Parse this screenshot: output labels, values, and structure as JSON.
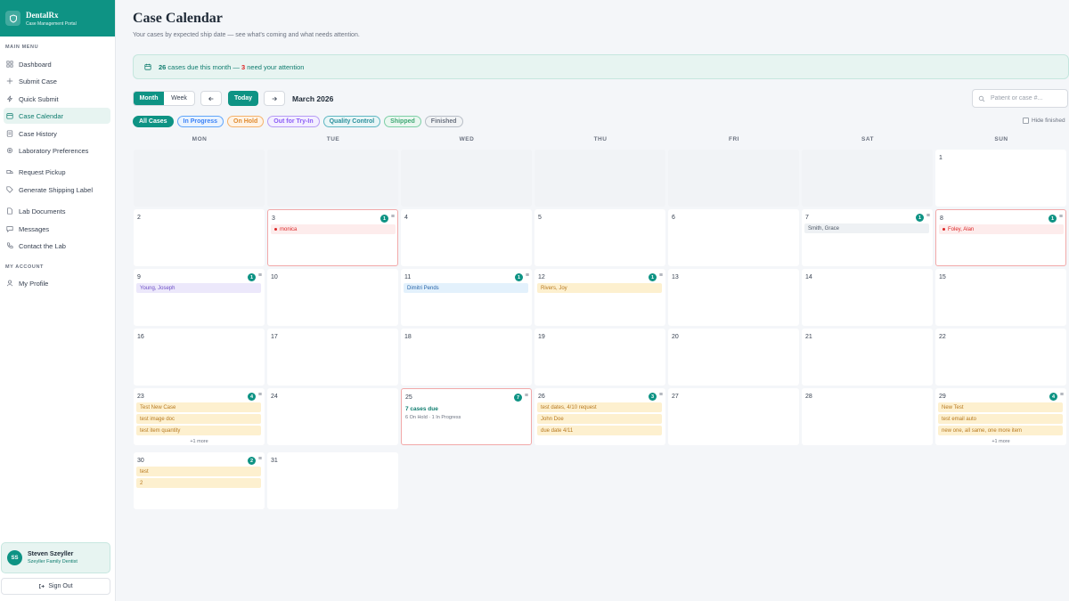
{
  "brand": {
    "name": "DentalRx",
    "sub": "Case Management Portal"
  },
  "sidebar": {
    "main_label": "MAIN MENU",
    "account_label": "MY ACCOUNT",
    "items": [
      {
        "label": "Dashboard",
        "icon": "grid-icon"
      },
      {
        "label": "Submit Case",
        "icon": "plus-icon"
      },
      {
        "label": "Quick Submit",
        "icon": "bolt-icon"
      },
      {
        "label": "Case Calendar",
        "icon": "calendar-icon"
      },
      {
        "label": "Case History",
        "icon": "history-icon"
      },
      {
        "label": "Laboratory Preferences",
        "icon": "gear-icon"
      },
      {
        "label": "Request Pickup",
        "icon": "truck-icon"
      },
      {
        "label": "Generate Shipping Label",
        "icon": "tag-icon"
      },
      {
        "label": "Lab Documents",
        "icon": "document-icon"
      },
      {
        "label": "Messages",
        "icon": "message-icon"
      },
      {
        "label": "Contact the Lab",
        "icon": "phone-icon"
      }
    ],
    "account_items": [
      {
        "label": "My Profile",
        "icon": "user-icon"
      }
    ]
  },
  "user": {
    "initials": "SS",
    "name": "Steven Szeyller",
    "org": "Szeyller Family Dentist"
  },
  "signout": "Sign Out",
  "page": {
    "title": "Case Calendar",
    "subtitle": "Your cases by expected ship date — see what's coming and what needs attention."
  },
  "banner": {
    "count": "26",
    "text1": " cases due this month — ",
    "attention": "3",
    "text2": " need your attention"
  },
  "toolbar": {
    "view_month": "Month",
    "view_week": "Week",
    "today": "Today",
    "month_label": "March 2026",
    "search_placeholder": "Patient or case #..."
  },
  "filters": [
    {
      "label": "All Cases",
      "active": true,
      "color": "#0e9384",
      "bg": "#0e9384",
      "text": "#ffffff"
    },
    {
      "label": "In Progress",
      "color": "#60a5fa",
      "bg": "#eaf3fe",
      "text": "#3b82f6"
    },
    {
      "label": "On Hold",
      "color": "#f5b26b",
      "bg": "#fef3e6",
      "text": "#e08a2e"
    },
    {
      "label": "Out for Try-In",
      "color": "#b69cf5",
      "bg": "#f3efff",
      "text": "#8b5cf6"
    },
    {
      "label": "Quality Control",
      "color": "#5fb7c2",
      "bg": "#e9f6f7",
      "text": "#2a8f9c"
    },
    {
      "label": "Shipped",
      "color": "#7dcfa6",
      "bg": "#eaf7f0",
      "text": "#3fa874"
    },
    {
      "label": "Finished",
      "color": "#b8bec7",
      "bg": "#f1f3f5",
      "text": "#6b7280"
    }
  ],
  "hide_finished": "Hide finished",
  "weekdays": [
    "MON",
    "TUE",
    "WED",
    "THU",
    "FRI",
    "SAT",
    "SUN"
  ],
  "days": [
    {
      "day": "1"
    },
    {
      "day": "2"
    },
    {
      "day": "3",
      "count": "1",
      "alert": true,
      "cases": [
        {
          "label": "monica",
          "status": "alert"
        }
      ]
    },
    {
      "day": "4"
    },
    {
      "day": "5"
    },
    {
      "day": "6"
    },
    {
      "day": "7",
      "count": "1",
      "cases": [
        {
          "label": "Smith, Grace",
          "status": "finished"
        }
      ]
    },
    {
      "day": "8",
      "count": "1",
      "alert": true,
      "cases": [
        {
          "label": "Foley, Alan",
          "status": "alert"
        }
      ]
    },
    {
      "day": "9",
      "count": "1",
      "cases": [
        {
          "label": "Young, Joseph",
          "status": "tryin"
        }
      ]
    },
    {
      "day": "10"
    },
    {
      "day": "11",
      "count": "1",
      "cases": [
        {
          "label": "Dimitri Pends",
          "status": "progress"
        }
      ]
    },
    {
      "day": "12",
      "count": "1",
      "cases": [
        {
          "label": "Rivers, Joy",
          "status": "hold"
        }
      ]
    },
    {
      "day": "13"
    },
    {
      "day": "14"
    },
    {
      "day": "15"
    },
    {
      "day": "16"
    },
    {
      "day": "17"
    },
    {
      "day": "18"
    },
    {
      "day": "19"
    },
    {
      "day": "20"
    },
    {
      "day": "21"
    },
    {
      "day": "22"
    },
    {
      "day": "23",
      "count": "4",
      "cases": [
        {
          "label": "Test New Case",
          "status": "hold"
        },
        {
          "label": "test image doc",
          "status": "hold"
        },
        {
          "label": "test item quantity",
          "status": "hold"
        }
      ],
      "more": "+1 more"
    },
    {
      "day": "24"
    },
    {
      "day": "25",
      "count": "7",
      "alert": true,
      "summary_title": "7 cases due",
      "summary_sub": "6 On Hold · 1 In Progress"
    },
    {
      "day": "26",
      "count": "3",
      "cases": [
        {
          "label": "test dates, 4/10 request",
          "status": "hold"
        },
        {
          "label": "John Doe",
          "status": "hold"
        },
        {
          "label": "due date 4/11",
          "status": "hold"
        }
      ]
    },
    {
      "day": "27"
    },
    {
      "day": "28"
    },
    {
      "day": "29",
      "count": "4",
      "cases": [
        {
          "label": "New Test",
          "status": "hold"
        },
        {
          "label": "test email auto",
          "status": "hold"
        },
        {
          "label": "new one, all same, one more item",
          "status": "hold"
        }
      ],
      "more": "+1 more"
    },
    {
      "day": "30",
      "count": "2",
      "cases": [
        {
          "label": "test",
          "status": "hold"
        },
        {
          "label": "2",
          "status": "hold"
        }
      ]
    },
    {
      "day": "31"
    }
  ],
  "menu_glyph": "≡",
  "colors": {
    "accent": "#0e9384",
    "alert_bg": "#fdecec",
    "alert_text": "#dc2626",
    "hold_bg": "#fdf0cf",
    "hold_text": "#b7791f",
    "progress_bg": "#e3f1fc",
    "progress_text": "#2563a8",
    "tryin_bg": "#ece8fb",
    "tryin_text": "#6d4fc6",
    "finished_bg": "#eef1f4",
    "finished_text": "#4b5563"
  }
}
